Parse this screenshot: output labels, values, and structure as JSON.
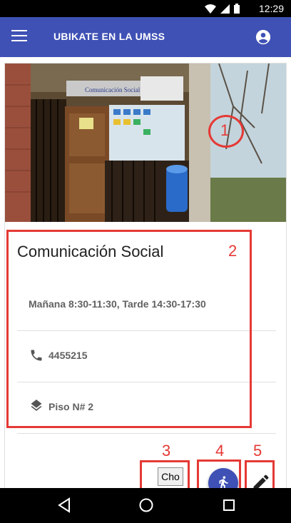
{
  "status_bar": {
    "time": "12:29"
  },
  "app_bar": {
    "title": "UBIKATE EN LA UMSS",
    "menu_icon": "menu-icon",
    "account_icon": "account-circle-icon"
  },
  "place": {
    "name": "Comunicación Social",
    "hours": "Mañana 8:30-11:30, Tarde 14:30-17:30",
    "phone": "4455215",
    "floor": "Piso N# 2",
    "photo_sign": "Comunicación Social"
  },
  "actions": {
    "choose_button_label": "Cho",
    "walk_icon": "directions-walk-icon",
    "edit_icon": "edit-pencil-icon"
  },
  "annotations": [
    "1",
    "2",
    "3",
    "4",
    "5"
  ],
  "colors": {
    "primary": "#3f51b5",
    "annotation": "#e53935"
  }
}
